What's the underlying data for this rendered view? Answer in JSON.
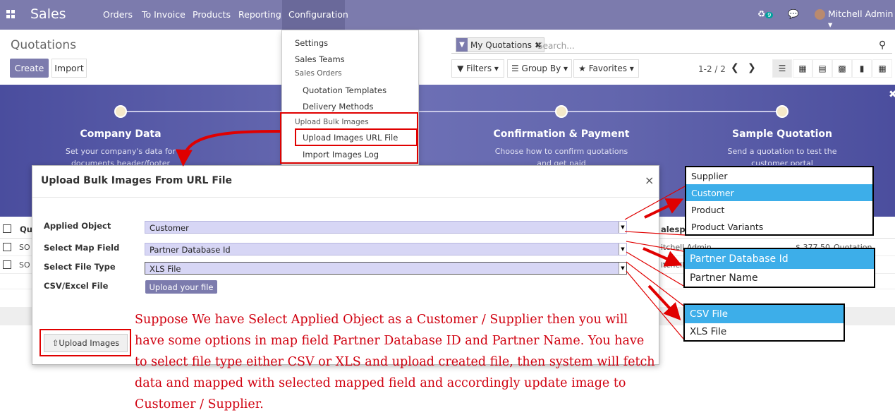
{
  "nav": {
    "brand": "Sales",
    "menu": [
      "Orders",
      "To Invoice",
      "Products",
      "Reporting",
      "Configuration"
    ],
    "activity_count": "9",
    "user": "Mitchell Admin"
  },
  "control": {
    "title": "Quotations",
    "create": "Create",
    "import": "Import",
    "facet": "My Quotations",
    "search_placeholder": "Search...",
    "filters": "Filters",
    "group_by": "Group By",
    "favorites": "Favorites",
    "pager": "1-2 / 2"
  },
  "config_menu": {
    "settings": "Settings",
    "sales_teams": "Sales Teams",
    "sales_orders_header": "Sales Orders",
    "quotation_templates": "Quotation Templates",
    "delivery_methods": "Delivery Methods",
    "bulk_header": "Upload Bulk Images",
    "upload_url_file": "Upload Images URL File",
    "import_log": "Import Images Log"
  },
  "banner": {
    "step1_title": "Company Data",
    "step1_text": "Set your company's data for documents header/footer",
    "step3_title": "Confirmation & Payment",
    "step3_text": "Choose how to confirm quotations and get paid",
    "step4_title": "Sample Quotation",
    "step4_text": "Send a quotation to test the customer portal"
  },
  "table_fragments": {
    "col_number": "Qu",
    "col_salesperson": "alesp",
    "row1_num": "SO",
    "row2_num": "SO",
    "row1_salesperson": "itchell Admin",
    "row1_total": "$ 377.50",
    "row1_status": "Quotation",
    "row2_salesperson": "itchell"
  },
  "modal": {
    "title": "Upload Bulk Images From URL File",
    "close": "×",
    "applied_object_label": "Applied Object",
    "applied_object_value": "Customer",
    "map_field_label": "Select Map Field",
    "map_field_value": "Partner Database Id",
    "file_type_label": "Select File Type",
    "file_type_value": "XLS File",
    "csv_label": "CSV/Excel File",
    "upload_file": "Upload your file",
    "upload_images": "Upload Images"
  },
  "note": "Suppose We have Select Applied Object as a Customer / Supplier then you will have some options in map field Partner Database ID and Partner Name. You have to select file type either CSV or XLS and upload created file, then system will fetch data and mapped with selected mapped field and accordingly update image to Customer / Supplier.",
  "callouts": {
    "applied_object_options": [
      "Supplier",
      "Customer",
      "Product",
      "Product Variants"
    ],
    "map_field_options": [
      "Partner Database Id",
      "Partner Name"
    ],
    "file_type_options": [
      "CSV File",
      "XLS File"
    ]
  },
  "colors": {
    "brand": "#7c7bad",
    "highlight": "#e00000",
    "selected_option": "#3daee9"
  }
}
